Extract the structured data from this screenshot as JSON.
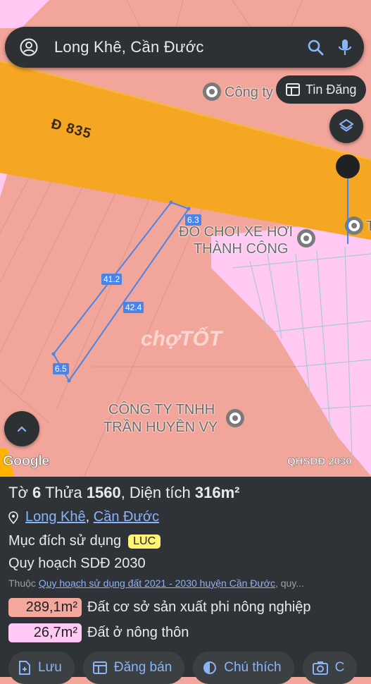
{
  "search": {
    "query": "Long Khê, Cần Đước"
  },
  "chip": {
    "label": "Tin Đăng"
  },
  "map": {
    "road": "Đ 835",
    "poi_top": "Công ty",
    "poi_toy": [
      "ĐỒ CHƠI XE HƠI",
      "THÀNH CÔNG"
    ],
    "poi_company": [
      "CÔNG TY TNHH",
      "TRẦN HUYỀN VY"
    ],
    "dims": [
      "6.3",
      "41.2",
      "42.4",
      "6.5"
    ],
    "watermark": "chợTỐT",
    "attribution": "Google",
    "layer_label": "QHSDĐ 2030",
    "edge_letter": "T"
  },
  "parcel": {
    "sheet_label": "Tờ",
    "sheet": "6",
    "plot_label": "Thửa",
    "plot": "1560",
    "area_label": "Diện tích",
    "area": "316m²",
    "ward": "Long Khê",
    "district": "Cần Đước",
    "purpose_label": "Mục đích sử dụng",
    "purpose_code": "LUC",
    "plan_label": "Quy hoạch SDĐ 2030",
    "belong_prefix": "Thuộc",
    "belong_link": "Quy hoạch sử dụng đất 2021 - 2030 huyện Cần Đước",
    "belong_suffix": ", quy...",
    "zones": [
      {
        "area": "289,1m²",
        "label": "Đất cơ sở sản xuất phi nông nghiệp",
        "color": "#f4a79b"
      },
      {
        "area": "26,7m²",
        "label": "Đất ở nông thôn",
        "color": "#ffc8f5"
      }
    ]
  },
  "actions": [
    "Lưu",
    "Đăng bán",
    "Chú thích",
    "C"
  ]
}
